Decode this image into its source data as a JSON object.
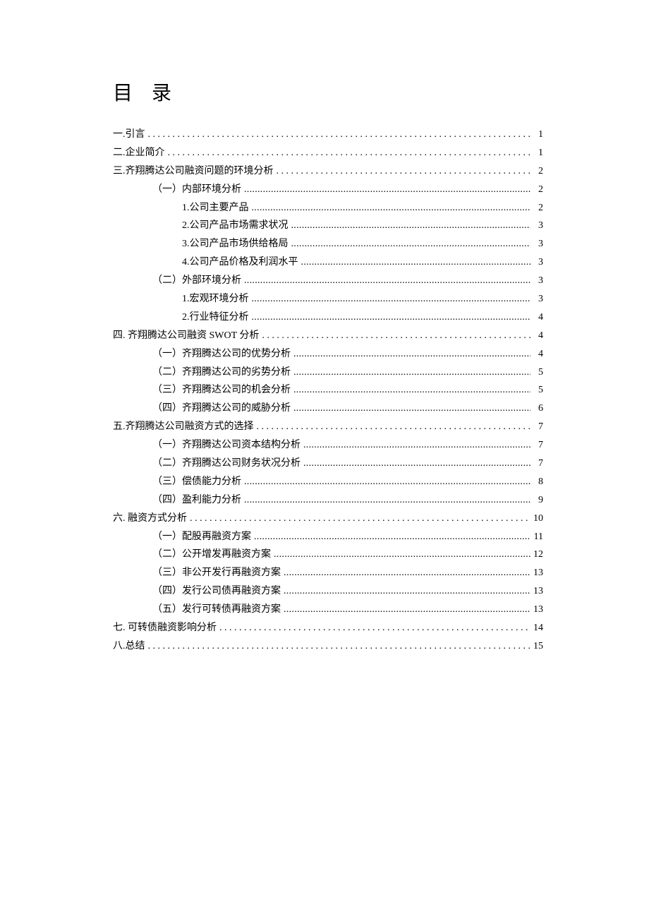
{
  "title": "目 录",
  "toc": [
    {
      "level": 1,
      "label": "一.引言",
      "page": "1"
    },
    {
      "level": 1,
      "label": "二.企业简介",
      "page": "1"
    },
    {
      "level": 1,
      "label": "三.齐翔腾达公司融资问题的环境分析",
      "page": "2"
    },
    {
      "level": 2,
      "label": "（一）内部环境分析",
      "page": "2"
    },
    {
      "level": 3,
      "label": "1.公司主要产品",
      "page": "2"
    },
    {
      "level": 3,
      "label": "2.公司产品市场需求状况",
      "page": "3"
    },
    {
      "level": 3,
      "label": "3.公司产品市场供给格局",
      "page": "3"
    },
    {
      "level": 3,
      "label": "4.公司产品价格及利润水平",
      "page": "3"
    },
    {
      "level": 2,
      "label": "（二）外部环境分析",
      "page": "3"
    },
    {
      "level": 3,
      "label": "1.宏观环境分析",
      "page": "3"
    },
    {
      "level": 3,
      "label": "2.行业特征分析",
      "page": "4"
    },
    {
      "level": 1,
      "label": "四. 齐翔腾达公司融资 SWOT 分析",
      "page": "4"
    },
    {
      "level": 2,
      "label": "（一）齐翔腾达公司的优势分析",
      "page": "4"
    },
    {
      "level": 2,
      "label": "（二）齐翔腾达公司的劣势分析",
      "page": "5"
    },
    {
      "level": 2,
      "label": "（三）齐翔腾达公司的机会分析",
      "page": "5"
    },
    {
      "level": 2,
      "label": "（四）齐翔腾达公司的威胁分析",
      "page": "6"
    },
    {
      "level": 1,
      "label": "五.齐翔腾达公司融资方式的选择",
      "page": "7"
    },
    {
      "level": 2,
      "label": "（一）齐翔腾达公司资本结构分析",
      "page": "7"
    },
    {
      "level": 2,
      "label": "（二）齐翔腾达公司财务状况分析",
      "page": "7"
    },
    {
      "level": 2,
      "label": "（三）偿债能力分析",
      "page": "8"
    },
    {
      "level": 2,
      "label": "（四）盈利能力分析",
      "page": "9"
    },
    {
      "level": 1,
      "label": "六. 融资方式分析",
      "page": "10"
    },
    {
      "level": 2,
      "label": "（一）配股再融资方案",
      "page": "11"
    },
    {
      "level": 2,
      "label": "（二）公开增发再融资方案",
      "page": "12"
    },
    {
      "level": 2,
      "label": "（三）非公开发行再融资方案",
      "page": "13"
    },
    {
      "level": 2,
      "label": "（四）发行公司债再融资方案",
      "page": "13"
    },
    {
      "level": 2,
      "label": "（五）发行可转债再融资方案",
      "page": "13"
    },
    {
      "level": 1,
      "label": "七. 可转债融资影响分析",
      "page": "14"
    },
    {
      "level": 1,
      "label": "八.总结",
      "page": "15"
    }
  ]
}
